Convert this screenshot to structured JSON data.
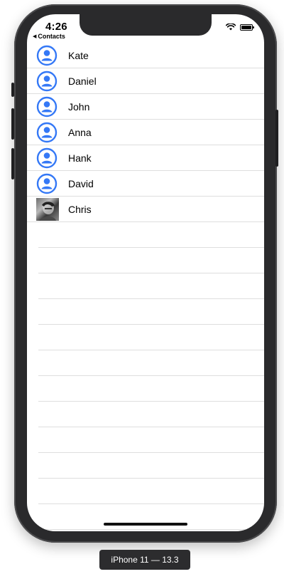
{
  "status_bar": {
    "time": "4:26",
    "back_label": "Contacts",
    "back_arrow": "◀"
  },
  "contacts": [
    {
      "name": "Kate",
      "avatar": "person-icon"
    },
    {
      "name": "Daniel",
      "avatar": "person-icon"
    },
    {
      "name": "John",
      "avatar": "person-icon"
    },
    {
      "name": "Anna",
      "avatar": "person-icon"
    },
    {
      "name": "Hank",
      "avatar": "person-icon"
    },
    {
      "name": "David",
      "avatar": "person-icon"
    },
    {
      "name": "Chris",
      "avatar": "photo"
    }
  ],
  "device_label": "iPhone 11 — 13.3",
  "colors": {
    "accent": "#3478f6"
  }
}
